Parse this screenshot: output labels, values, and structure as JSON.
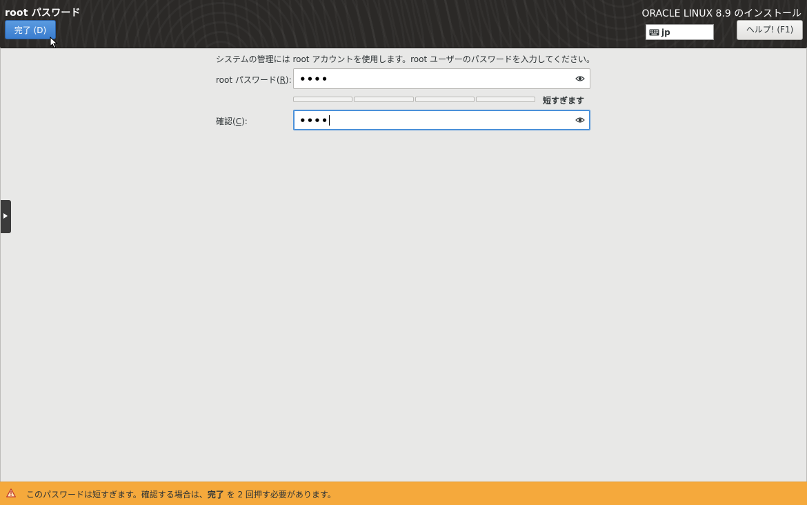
{
  "header": {
    "page_title": "root パスワード",
    "done_label": "完了 (D)",
    "product_title": "ORACLE LINUX 8.9 のインストール",
    "keyboard_layout": "jp",
    "help_label": "ヘルプ! (F1)"
  },
  "form": {
    "intro": "システムの管理には root アカウントを使用します。root ユーザーのパスワードを入力してください。",
    "password_label_prefix": "root パスワード(",
    "password_label_key": "R",
    "password_label_suffix": "):",
    "password_value": "••••",
    "strength_text": "短すぎます",
    "strength_fraction": 0,
    "confirm_label_prefix": "確認(",
    "confirm_label_key": "C",
    "confirm_label_suffix": "):",
    "confirm_value": "••••"
  },
  "warning": {
    "text_before": "このパスワードは短すぎます。確認する場合は、",
    "text_bold": "完了",
    "text_after": " を 2 回押す必要があります。",
    "color": "#f5a93c"
  },
  "colors": {
    "header_bg": "#2b2927",
    "accent": "#4a90d9",
    "background": "#e8e8e7"
  }
}
